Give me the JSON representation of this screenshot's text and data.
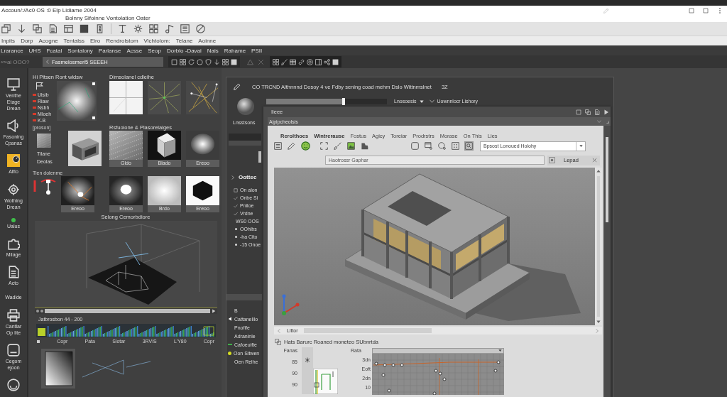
{
  "title_bar": {
    "address": "Accoun/:/Ac0 OS :0 Elp Lidiame 2004",
    "subtitle": "Bolnny Sifoinne Vontolation Oater"
  },
  "light_menu": [
    "Inpits",
    "Dorp",
    "Acogne",
    "Tentalss",
    "Eiro",
    "Rendrolstom",
    "Vichtolom:",
    "Telane",
    "Aoinne"
  ],
  "dark_menu": [
    "Lrarance",
    "UHS",
    "Fcatal",
    "Sontalony",
    "Parlanse",
    "Acsse",
    "Seop",
    "Dorblo -Davai",
    "Nais",
    "Rahame",
    "PSII"
  ],
  "toolbar": {
    "label": "«»ai OOO?",
    "tab": "Fasmelosmeri5 SEEEH"
  },
  "sidebar": [
    {
      "kind": "monitor",
      "labels": [
        "Venthe",
        "Etage",
        "Drean"
      ]
    },
    {
      "kind": "speaker",
      "labels": [
        "Fasoning",
        "Cpanas"
      ]
    },
    {
      "kind": "tile",
      "labels": [
        "Alfio"
      ]
    },
    {
      "kind": "gear",
      "labels": [
        "Wothing",
        "Drean"
      ]
    },
    {
      "kind": "dot",
      "labels": [
        "Ualus"
      ]
    },
    {
      "kind": "puzzle",
      "labels": [
        "Milage"
      ]
    },
    {
      "kind": "document",
      "labels": [
        "Acto"
      ]
    },
    {
      "kind": "text",
      "labels": [
        "Wadlde"
      ]
    },
    {
      "kind": "printer",
      "labels": [
        "Cantlar",
        "Op lite"
      ]
    },
    {
      "kind": "frame",
      "labels": [
        "Cegom",
        "ejoon"
      ]
    },
    {
      "kind": "ring"
    }
  ],
  "left_panel": {
    "title": "Hi Pitsen Ront wldsw",
    "gallery_title": "Dimsolanel cdleihe",
    "layers": [
      "Ulsib",
      "Riaw",
      "Nsbh",
      "Mloeh",
      "K.B"
    ],
    "gallery": [
      {
        "kind": "grid"
      },
      {
        "kind": "rays"
      },
      {
        "kind": "lines"
      }
    ],
    "group_label": "[proson]",
    "materials_title": "Rsfuolone & Plasorelalges",
    "material_labels": [
      "Tilane",
      "Deolas"
    ],
    "materials": [
      {
        "kind": "mesh",
        "caption": "Gldo"
      },
      {
        "kind": "prism",
        "caption": "Blado"
      },
      {
        "kind": "sphere",
        "caption": "Ereoo"
      },
      {
        "kind": "glow",
        "caption": "Ereoo"
      },
      {
        "kind": "soft",
        "caption": "Brdo"
      },
      {
        "kind": "hexagon",
        "caption": "Ereoo"
      }
    ],
    "lights_label": "Tien dolenme",
    "light_caption": "Ereoo",
    "scene_title": "Selong Cemorbdiore",
    "timeline": {
      "title": "Jatbrosbon 44 - 200",
      "labels": [
        "Copr",
        "Pata",
        "Slotar",
        "3RVIS",
        "L'Y80",
        "Copr"
      ]
    }
  },
  "editor": {
    "header": "CO TRCND Althnnnd Dosoy 4 ve Fdby sening coad mehm Dslo Wittnmslnet",
    "header_tag": "3Z",
    "sphere_label": "Lnsstsons",
    "slider": {
      "level": 0.64
    },
    "dropdown": "Lnosoesis",
    "library": "Uownnlocr Lishory",
    "outline": {
      "title": "Oottec",
      "items": [
        {
          "kind": "box",
          "label": "On alon"
        },
        {
          "kind": "check",
          "label": "Onbe Si"
        },
        {
          "kind": "check",
          "label": "Pniloe"
        },
        {
          "kind": "check",
          "label": "Vrdne"
        },
        {
          "kind": "plain",
          "label": "WS0 OOS"
        },
        {
          "kind": "bullet",
          "label": "OOhibs"
        },
        {
          "kind": "bullet",
          "label": "-ha Cito"
        },
        {
          "kind": "bullet",
          "label": "-15 Onoe"
        }
      ]
    },
    "layers": [
      {
        "kind": "plain",
        "label": "B"
      },
      {
        "kind": "arrow",
        "label": "Cattanelilo"
      },
      {
        "kind": "plain",
        "label": "Pnofife"
      },
      {
        "kind": "plain",
        "label": "Adraninle"
      },
      {
        "kind": "dash",
        "label": "Cafoeuifte",
        "color": "#3fae49"
      },
      {
        "kind": "dot",
        "label": "Oon Sitwen",
        "color": "#d4dc22"
      },
      {
        "kind": "plain",
        "label": "Oen Relhe"
      }
    ],
    "window": {
      "title": "Iieee",
      "subtitle": "Aipipcheolsis",
      "menu": [
        {
          "label": "Rerolthoes",
          "bold": true
        },
        {
          "label": "Wintrerause",
          "bold": true
        },
        {
          "label": "Fostus",
          "bold": false
        },
        {
          "label": "Agicy",
          "bold": false
        },
        {
          "label": "Toreiar",
          "bold": false
        },
        {
          "label": "Prodrstrs",
          "bold": false
        },
        {
          "label": "Morase",
          "bold": false
        },
        {
          "label": "On This",
          "bold": false
        },
        {
          "label": "Lies",
          "bold": false
        }
      ],
      "preset": "Bpsost Lonoued Holohy",
      "search": {
        "placeholder": "Haotrossr Gaphar"
      },
      "load_button": "Lepad",
      "view_tab": "Littor",
      "panel_title": "Hats Barurc Roaned moneteo SUbnrtda",
      "timing": {
        "title": "Fanas",
        "labels": [
          "85",
          "90",
          "90"
        ]
      },
      "plot": {
        "title": "Rata",
        "labels": [
          "3dn",
          "Eoft",
          "2dn",
          "10"
        ]
      }
    }
  }
}
